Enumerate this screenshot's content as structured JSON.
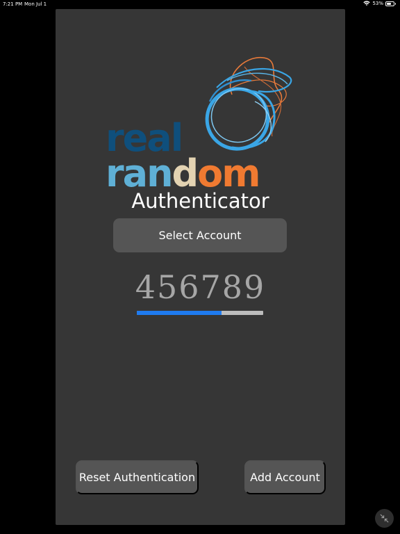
{
  "status_bar": {
    "time": "7:21 PM",
    "date": "Mon Jul 1",
    "battery": "53%",
    "battery_level": 0.53,
    "icons": [
      "wifi-icon",
      "battery-icon"
    ]
  },
  "logo": {
    "word_top": "real",
    "word_bottom_letters": [
      "ran",
      "d",
      "om"
    ],
    "colors": {
      "real": "#0f4f7c",
      "ran": "#5fb0d6",
      "d": "#e3d3b2",
      "om": "#f07a31",
      "swirl_blue": "#3aa6e6",
      "swirl_orange": "#e87a3a"
    }
  },
  "app": {
    "subtitle": "Authenticator",
    "select_account_label": "Select Account",
    "otp_code": "456789",
    "progress": 0.67,
    "progress_color": "#1f7bef",
    "reset_label": "Reset Authentication",
    "add_account_label": "Add Account"
  },
  "system": {
    "minimize_icon": "minimize-icon"
  }
}
